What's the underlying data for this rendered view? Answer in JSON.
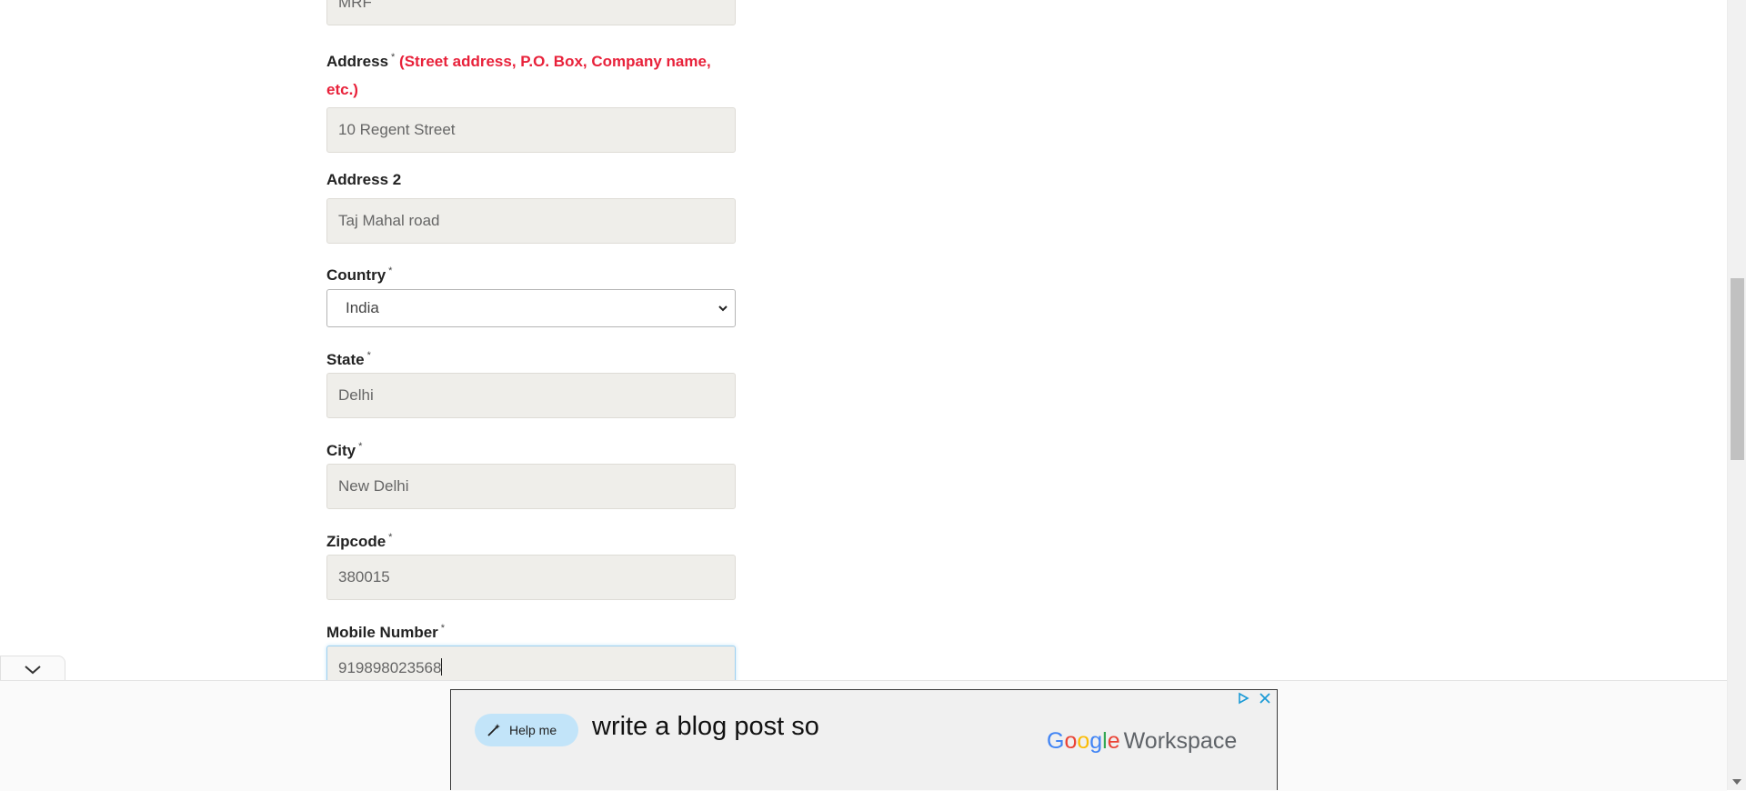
{
  "form": {
    "company_value": "MRF",
    "address_label": "Address",
    "address_required": "*",
    "address_note": "(Street address, P.O. Box, Company name, etc.)",
    "address_value": "10 Regent Street",
    "address2_label": "Address 2",
    "address2_value": "Taj Mahal road",
    "country_label": "Country",
    "country_required": "*",
    "country_value": "India",
    "state_label": "State",
    "state_required": "*",
    "state_value": "Delhi",
    "city_label": "City",
    "city_required": "*",
    "city_value": "New Delhi",
    "zipcode_label": "Zipcode",
    "zipcode_required": "*",
    "zipcode_value": "380015",
    "mobile_label": "Mobile Number",
    "mobile_required": "*",
    "mobile_value": "919898023568"
  },
  "ad": {
    "button_label": "Help me",
    "headline": "write a blog post so",
    "brand_letters": [
      "G",
      "o",
      "o",
      "g",
      "l",
      "e"
    ],
    "brand_suffix": "Workspace"
  },
  "icons": {
    "collapse": "chevron-down-icon",
    "ad_choices": "ad-choices-icon",
    "ad_close": "close-icon",
    "help_pen": "pen-sparkle-icon"
  },
  "colors": {
    "required_note": "#e8213a",
    "field_bg": "#efeeea",
    "ad_pill": "#c2e4f9"
  }
}
